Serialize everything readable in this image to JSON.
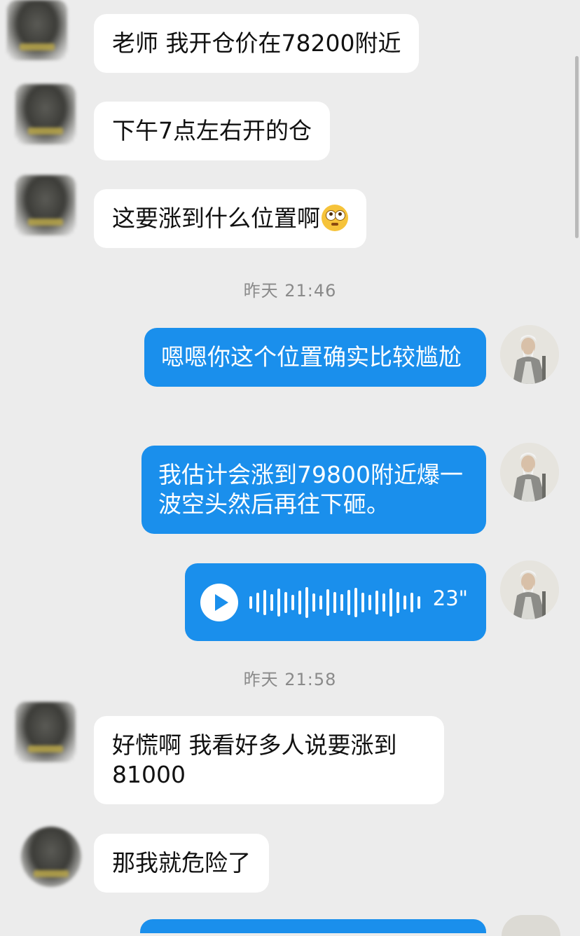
{
  "messages": [
    {
      "side": "in",
      "text": "老师 我开仓价在78200附近"
    },
    {
      "side": "in",
      "text": "下午7点左右开的仓"
    },
    {
      "side": "in",
      "text": "这要涨到什么位置啊",
      "emoji": "flushed-face-emoji"
    },
    {
      "side": "time",
      "text": "昨天 21:46"
    },
    {
      "side": "out",
      "text": "嗯嗯你这个位置确实比较尴尬"
    },
    {
      "side": "out",
      "text": "我估计会涨到79800附近爆一波空头然后再往下砸。"
    },
    {
      "side": "out-voice",
      "duration": "23\""
    },
    {
      "side": "time",
      "text": "昨天 21:58"
    },
    {
      "side": "in",
      "text": "好慌啊 我看好多人说要涨到81000"
    },
    {
      "side": "in",
      "text": "那我就危险了"
    }
  ],
  "colors": {
    "outgoing_bubble": "#1a8fec",
    "incoming_bubble": "#ffffff",
    "background": "#ececec",
    "timestamp": "#8a8a8a"
  },
  "icons": {
    "play": "play-icon",
    "voice": "voice-waveform-icon"
  }
}
